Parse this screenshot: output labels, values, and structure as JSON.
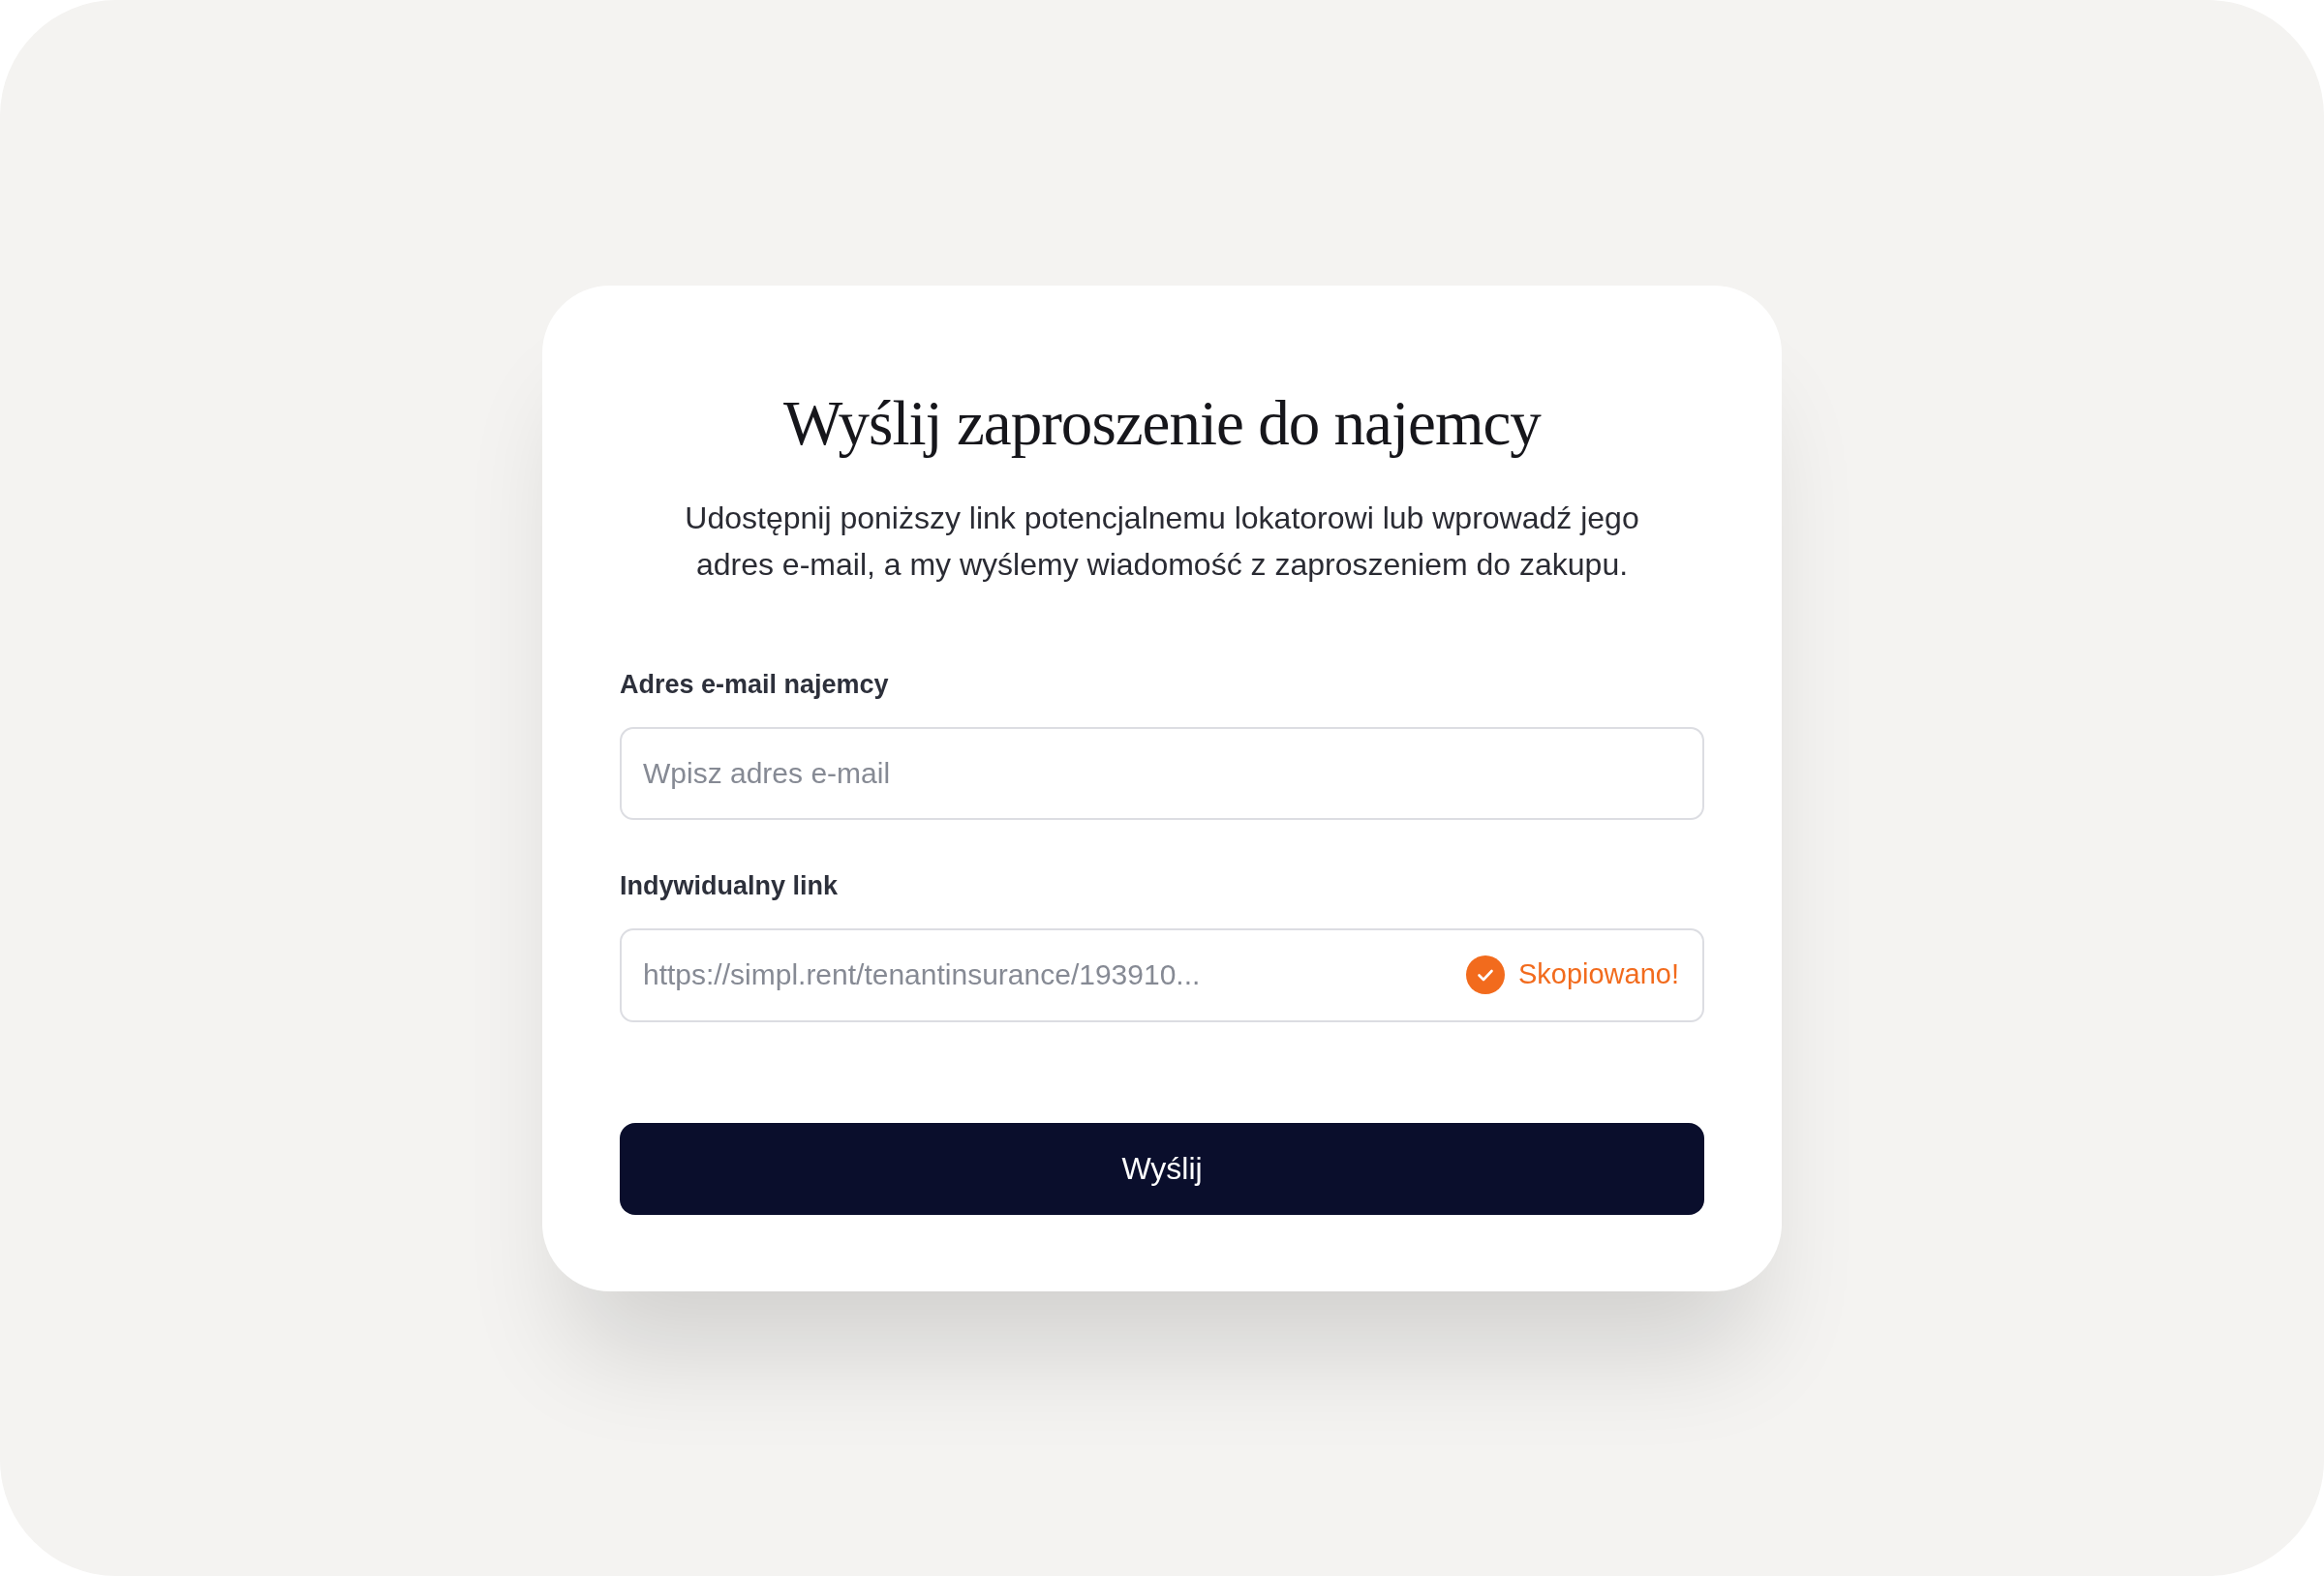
{
  "dialog": {
    "title": "Wyślij zaproszenie do najemcy",
    "description": "Udostępnij poniższy link potencjalnemu lokatorowi lub wprowadź jego adres e-mail, a my wyślemy wiadomość z zaproszeniem do zakupu.",
    "fields": [
      {
        "label": "Adres e-mail najemcy",
        "placeholder": "Wpisz adres e-mail"
      },
      {
        "label": "Indywidualny link",
        "value": "https://simpl.rent/tenantinsurance/193910...",
        "copied": true,
        "status": "Skopiowano!"
      }
    ],
    "submit_button": "Wyślij"
  }
}
